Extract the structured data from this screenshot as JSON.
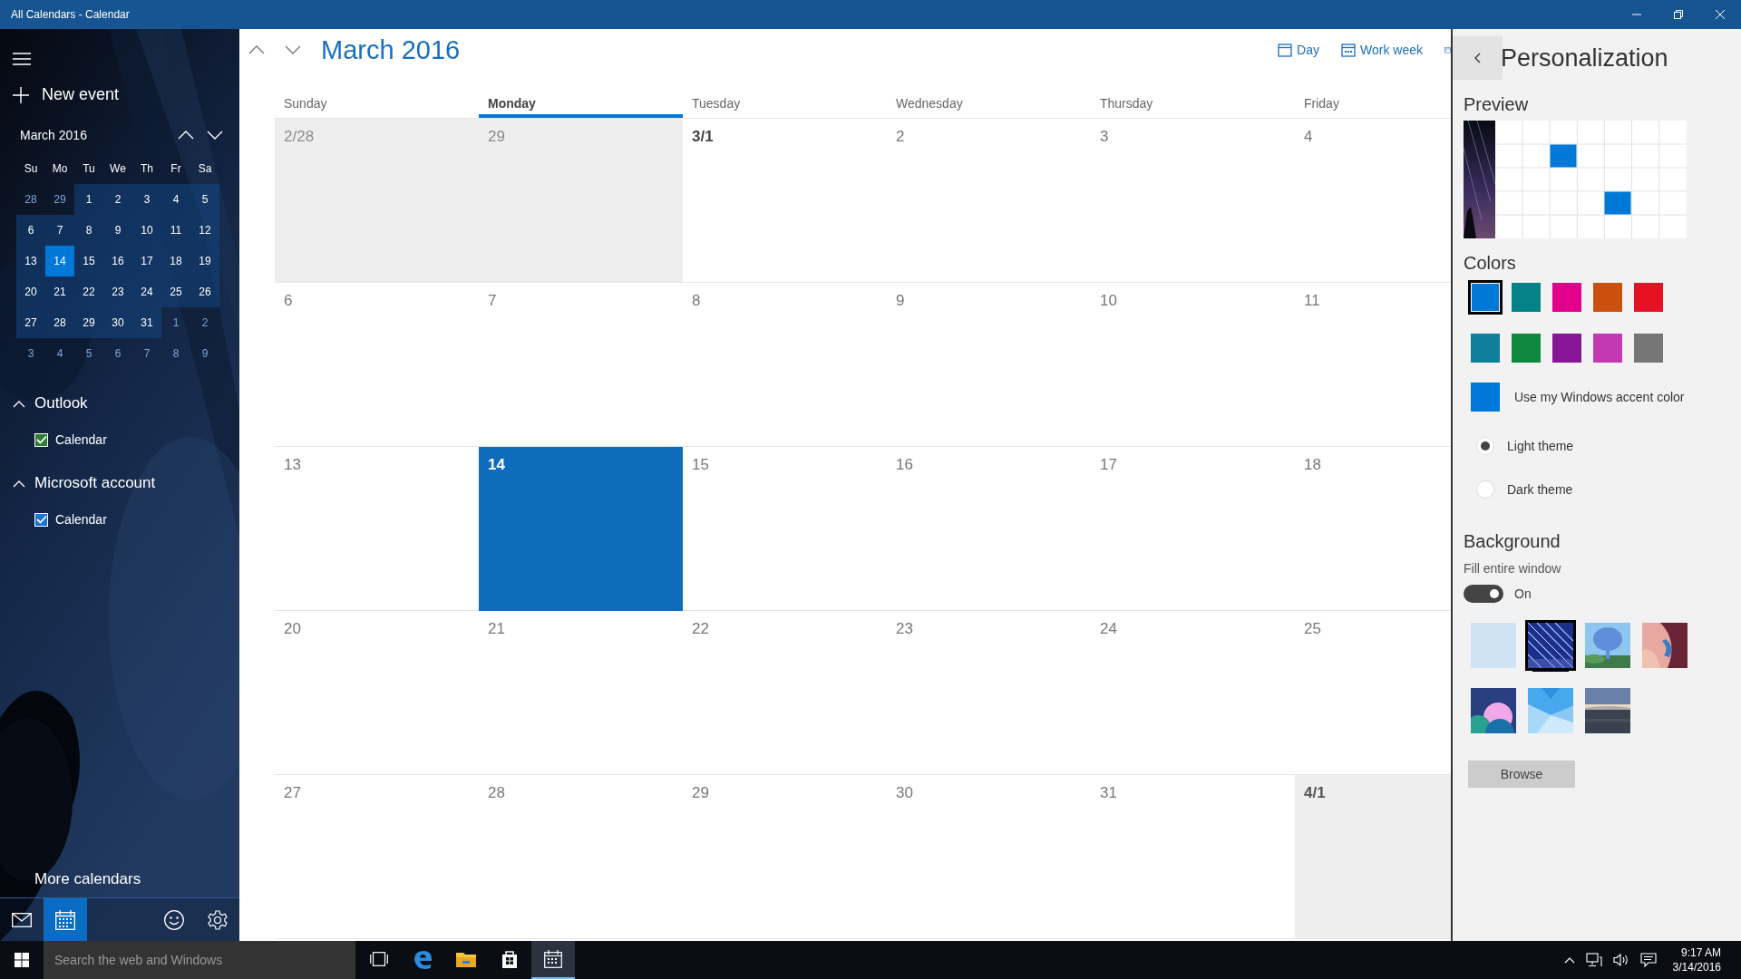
{
  "window": {
    "title": "All Calendars - Calendar"
  },
  "sidebar": {
    "new_event": "New event",
    "mini_calendar": {
      "title": "March 2016",
      "weekdays": [
        "Su",
        "Mo",
        "Tu",
        "We",
        "Th",
        "Fr",
        "Sa"
      ],
      "weeks": [
        [
          {
            "label": "28",
            "in_month": false,
            "today": false
          },
          {
            "label": "29",
            "in_month": false,
            "today": false
          },
          {
            "label": "1",
            "in_month": true,
            "today": false
          },
          {
            "label": "2",
            "in_month": true,
            "today": false
          },
          {
            "label": "3",
            "in_month": true,
            "today": false
          },
          {
            "label": "4",
            "in_month": true,
            "today": false
          },
          {
            "label": "5",
            "in_month": true,
            "today": false
          }
        ],
        [
          {
            "label": "6",
            "in_month": true,
            "today": false
          },
          {
            "label": "7",
            "in_month": true,
            "today": false
          },
          {
            "label": "8",
            "in_month": true,
            "today": false
          },
          {
            "label": "9",
            "in_month": true,
            "today": false
          },
          {
            "label": "10",
            "in_month": true,
            "today": false
          },
          {
            "label": "11",
            "in_month": true,
            "today": false
          },
          {
            "label": "12",
            "in_month": true,
            "today": false
          }
        ],
        [
          {
            "label": "13",
            "in_month": true,
            "today": false
          },
          {
            "label": "14",
            "in_month": true,
            "today": true
          },
          {
            "label": "15",
            "in_month": true,
            "today": false
          },
          {
            "label": "16",
            "in_month": true,
            "today": false
          },
          {
            "label": "17",
            "in_month": true,
            "today": false
          },
          {
            "label": "18",
            "in_month": true,
            "today": false
          },
          {
            "label": "19",
            "in_month": true,
            "today": false
          }
        ],
        [
          {
            "label": "20",
            "in_month": true,
            "today": false
          },
          {
            "label": "21",
            "in_month": true,
            "today": false
          },
          {
            "label": "22",
            "in_month": true,
            "today": false
          },
          {
            "label": "23",
            "in_month": true,
            "today": false
          },
          {
            "label": "24",
            "in_month": true,
            "today": false
          },
          {
            "label": "25",
            "in_month": true,
            "today": false
          },
          {
            "label": "26",
            "in_month": true,
            "today": false
          }
        ],
        [
          {
            "label": "27",
            "in_month": true,
            "today": false
          },
          {
            "label": "28",
            "in_month": true,
            "today": false
          },
          {
            "label": "29",
            "in_month": true,
            "today": false
          },
          {
            "label": "30",
            "in_month": true,
            "today": false
          },
          {
            "label": "31",
            "in_month": true,
            "today": false
          },
          {
            "label": "1",
            "in_month": false,
            "today": false
          },
          {
            "label": "2",
            "in_month": false,
            "today": false
          }
        ],
        [
          {
            "label": "3",
            "in_month": false,
            "today": false
          },
          {
            "label": "4",
            "in_month": false,
            "today": false
          },
          {
            "label": "5",
            "in_month": false,
            "today": false
          },
          {
            "label": "6",
            "in_month": false,
            "today": false
          },
          {
            "label": "7",
            "in_month": false,
            "today": false
          },
          {
            "label": "8",
            "in_month": false,
            "today": false
          },
          {
            "label": "9",
            "in_month": false,
            "today": false
          }
        ]
      ]
    },
    "accounts": [
      {
        "name": "Outlook",
        "expanded": true,
        "calendars": [
          {
            "name": "Calendar",
            "checked": true,
            "color": "#2e7d32"
          }
        ]
      },
      {
        "name": "Microsoft account",
        "expanded": true,
        "calendars": [
          {
            "name": "Calendar",
            "checked": true,
            "color": "#1a73d9"
          }
        ]
      }
    ],
    "more_calendars": "More calendars",
    "nav": [
      {
        "kind": "mail",
        "selected": false
      },
      {
        "kind": "calendar",
        "selected": true
      },
      {
        "kind": "feedback",
        "selected": false
      },
      {
        "kind": "settings",
        "selected": false
      }
    ]
  },
  "calendar": {
    "title": "March 2016",
    "views": [
      {
        "kind": "day",
        "label": "Day"
      },
      {
        "kind": "work-week",
        "label": "Work week"
      },
      {
        "kind": "week"
      }
    ],
    "columns": [
      {
        "label": "Sunday",
        "selected": false
      },
      {
        "label": "Monday",
        "selected": true
      },
      {
        "label": "Tuesday",
        "selected": false
      },
      {
        "label": "Wednesday",
        "selected": false
      },
      {
        "label": "Thursday",
        "selected": false
      },
      {
        "label": "Friday",
        "selected": false
      }
    ],
    "weeks": [
      [
        {
          "label": "2/28",
          "in_month": false,
          "month_start": false,
          "today": false
        },
        {
          "label": "29",
          "in_month": false,
          "month_start": false,
          "today": false
        },
        {
          "label": "3/1",
          "in_month": true,
          "month_start": true,
          "today": false
        },
        {
          "label": "2",
          "in_month": true,
          "month_start": false,
          "today": false
        },
        {
          "label": "3",
          "in_month": true,
          "month_start": false,
          "today": false
        },
        {
          "label": "4",
          "in_month": true,
          "month_start": false,
          "today": false
        }
      ],
      [
        {
          "label": "6",
          "in_month": true,
          "month_start": false,
          "today": false
        },
        {
          "label": "7",
          "in_month": true,
          "month_start": false,
          "today": false
        },
        {
          "label": "8",
          "in_month": true,
          "month_start": false,
          "today": false
        },
        {
          "label": "9",
          "in_month": true,
          "month_start": false,
          "today": false
        },
        {
          "label": "10",
          "in_month": true,
          "month_start": false,
          "today": false
        },
        {
          "label": "11",
          "in_month": true,
          "month_start": false,
          "today": false
        }
      ],
      [
        {
          "label": "13",
          "in_month": true,
          "month_start": false,
          "today": false
        },
        {
          "label": "14",
          "in_month": true,
          "month_start": false,
          "today": true
        },
        {
          "label": "15",
          "in_month": true,
          "month_start": false,
          "today": false
        },
        {
          "label": "16",
          "in_month": true,
          "month_start": false,
          "today": false
        },
        {
          "label": "17",
          "in_month": true,
          "month_start": false,
          "today": false
        },
        {
          "label": "18",
          "in_month": true,
          "month_start": false,
          "today": false
        }
      ],
      [
        {
          "label": "20",
          "in_month": true,
          "month_start": false,
          "today": false
        },
        {
          "label": "21",
          "in_month": true,
          "month_start": false,
          "today": false
        },
        {
          "label": "22",
          "in_month": true,
          "month_start": false,
          "today": false
        },
        {
          "label": "23",
          "in_month": true,
          "month_start": false,
          "today": false
        },
        {
          "label": "24",
          "in_month": true,
          "month_start": false,
          "today": false
        },
        {
          "label": "25",
          "in_month": true,
          "month_start": false,
          "today": false
        }
      ],
      [
        {
          "label": "27",
          "in_month": true,
          "month_start": false,
          "today": false
        },
        {
          "label": "28",
          "in_month": true,
          "month_start": false,
          "today": false
        },
        {
          "label": "29",
          "in_month": true,
          "month_start": false,
          "today": false
        },
        {
          "label": "30",
          "in_month": true,
          "month_start": false,
          "today": false
        },
        {
          "label": "31",
          "in_month": true,
          "month_start": false,
          "today": false
        },
        {
          "label": "4/1",
          "in_month": false,
          "month_start": true,
          "today": false
        }
      ]
    ]
  },
  "personalization": {
    "title": "Personalization",
    "preview_heading": "Preview",
    "colors_heading": "Colors",
    "colors": [
      {
        "color": "#0078d7",
        "selected": true
      },
      {
        "color": "#038387",
        "selected": false
      },
      {
        "color": "#e3008c",
        "selected": false
      },
      {
        "color": "#ca5010",
        "selected": false
      },
      {
        "color": "#e81123",
        "selected": false
      },
      {
        "color": "#0f7f9a",
        "selected": false
      },
      {
        "color": "#10893e",
        "selected": false
      },
      {
        "color": "#881798",
        "selected": false
      },
      {
        "color": "#c239b3",
        "selected": false
      },
      {
        "color": "#767676",
        "selected": false
      }
    ],
    "accent": {
      "label": "Use my Windows accent color",
      "color": "#0078d7"
    },
    "themes": [
      {
        "label": "Light theme",
        "selected": true
      },
      {
        "label": "Dark theme",
        "selected": false
      }
    ],
    "background_heading": "Background",
    "fill_label": "Fill entire window",
    "fill_toggle": {
      "on": true,
      "label": "On"
    },
    "backgrounds": [
      {
        "kind": "plain",
        "color": "#cfe3f5",
        "selected": false
      },
      {
        "kind": "picture",
        "selected": true
      },
      {
        "kind": "picture",
        "selected": false
      },
      {
        "kind": "picture",
        "selected": false
      },
      {
        "kind": "picture",
        "selected": false
      },
      {
        "kind": "picture",
        "selected": false
      },
      {
        "kind": "picture",
        "selected": false
      }
    ],
    "browse": "Browse"
  },
  "taskbar": {
    "search": {
      "placeholder": "Search the web and Windows"
    },
    "apps": [
      {
        "kind": "task-view",
        "selected": false
      },
      {
        "kind": "browser",
        "selected": false
      },
      {
        "kind": "folder",
        "selected": false
      },
      {
        "kind": "store",
        "selected": false
      },
      {
        "kind": "calendar",
        "selected": true
      }
    ],
    "time": "9:17 AM",
    "date": "3/14/2016"
  }
}
